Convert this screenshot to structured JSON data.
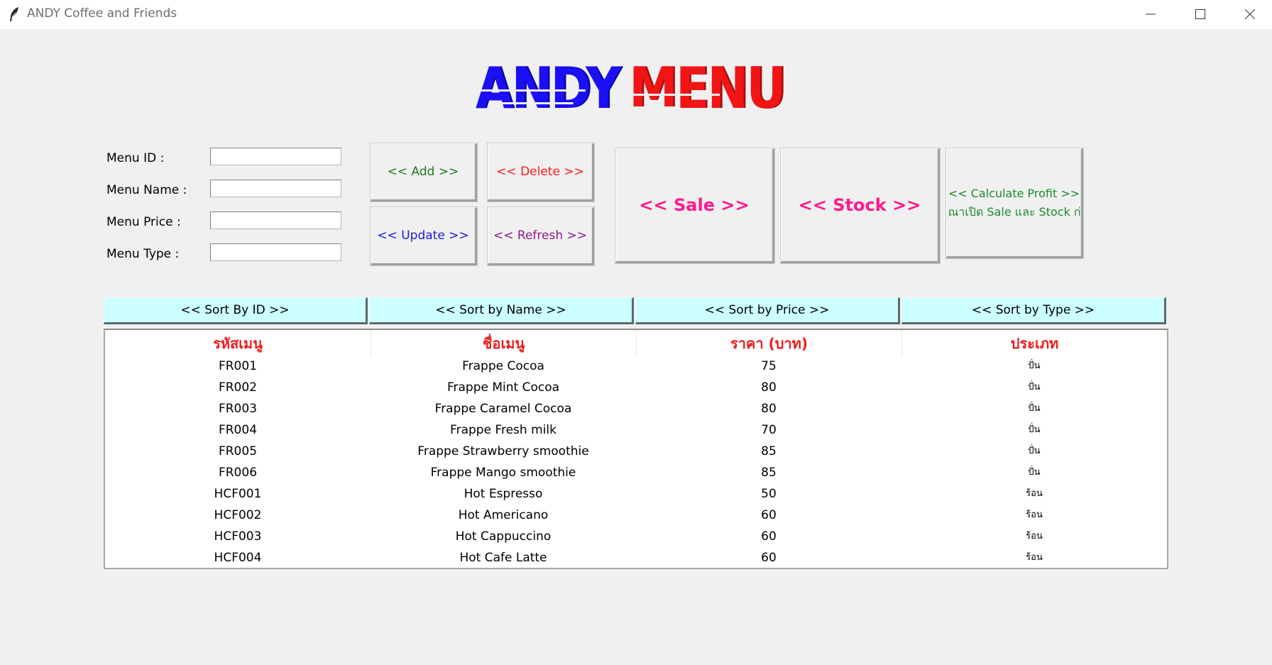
{
  "window": {
    "title": "ANDY Coffee and Friends"
  },
  "logo": {
    "part1": "ANDY",
    "part2": "MENU"
  },
  "form": {
    "menu_id_label": "Menu ID :",
    "menu_name_label": "Menu Name :",
    "menu_price_label": "Menu Price :",
    "menu_type_label": "Menu Type :",
    "menu_id_value": "",
    "menu_name_value": "",
    "menu_price_value": "",
    "menu_type_value": ""
  },
  "buttons": {
    "add": "<< Add >>",
    "delete": "<< Delete >>",
    "update": "<< Update >>",
    "refresh": "<< Refresh >>",
    "sale": "<< Sale >>",
    "stock": "<< Stock >>",
    "profit_line1": "<< Calculate Profit >>",
    "profit_line2": "คุณาเปิด Sale และ Stock ก่อ"
  },
  "sort": {
    "by_id": "<< Sort By ID >>",
    "by_name": "<< Sort by Name >>",
    "by_price": "<< Sort by Price >>",
    "by_type": "<< Sort by Type >>"
  },
  "table": {
    "headers": [
      "รหัสเมนู",
      "ชื่อเมนู",
      "ราคา (บาท)",
      "ประเภท"
    ],
    "rows": [
      [
        "FR001",
        "Frappe  Cocoa",
        "75",
        "ปั่น"
      ],
      [
        "FR002",
        "Frappe Mint Cocoa",
        "80",
        "ปั่น"
      ],
      [
        "FR003",
        "Frappe Caramel Cocoa",
        "80",
        "ปั่น"
      ],
      [
        "FR004",
        "Frappe Fresh milk",
        "70",
        "ปั่น"
      ],
      [
        "FR005",
        "Frappe Strawberry smoothie",
        "85",
        "ปั่น"
      ],
      [
        "FR006",
        "Frappe Mango smoothie",
        "85",
        "ปั่น"
      ],
      [
        "HCF001",
        "Hot Espresso",
        "50",
        "ร้อน"
      ],
      [
        "HCF002",
        "Hot Americano",
        "60",
        "ร้อน"
      ],
      [
        "HCF003",
        "Hot Cappuccino",
        "60",
        "ร้อน"
      ],
      [
        "HCF004",
        "Hot Cafe Latte",
        "60",
        "ร้อน"
      ]
    ]
  },
  "colors": {
    "logo_blue": "#1a0ff5",
    "logo_red": "#f21515",
    "add": "#1d7a1d",
    "delete": "#ff1a1a",
    "update": "#1a1adc",
    "refresh": "#8a1a8a",
    "sale_stock": "#ff1a8c",
    "profit": "#1d8a2e",
    "sort_bg": "#ccffff",
    "table_header": "#ee1c1c"
  },
  "icons": {
    "app": "feather-icon",
    "minimize": "minimize-icon",
    "maximize": "maximize-icon",
    "close": "close-icon"
  }
}
